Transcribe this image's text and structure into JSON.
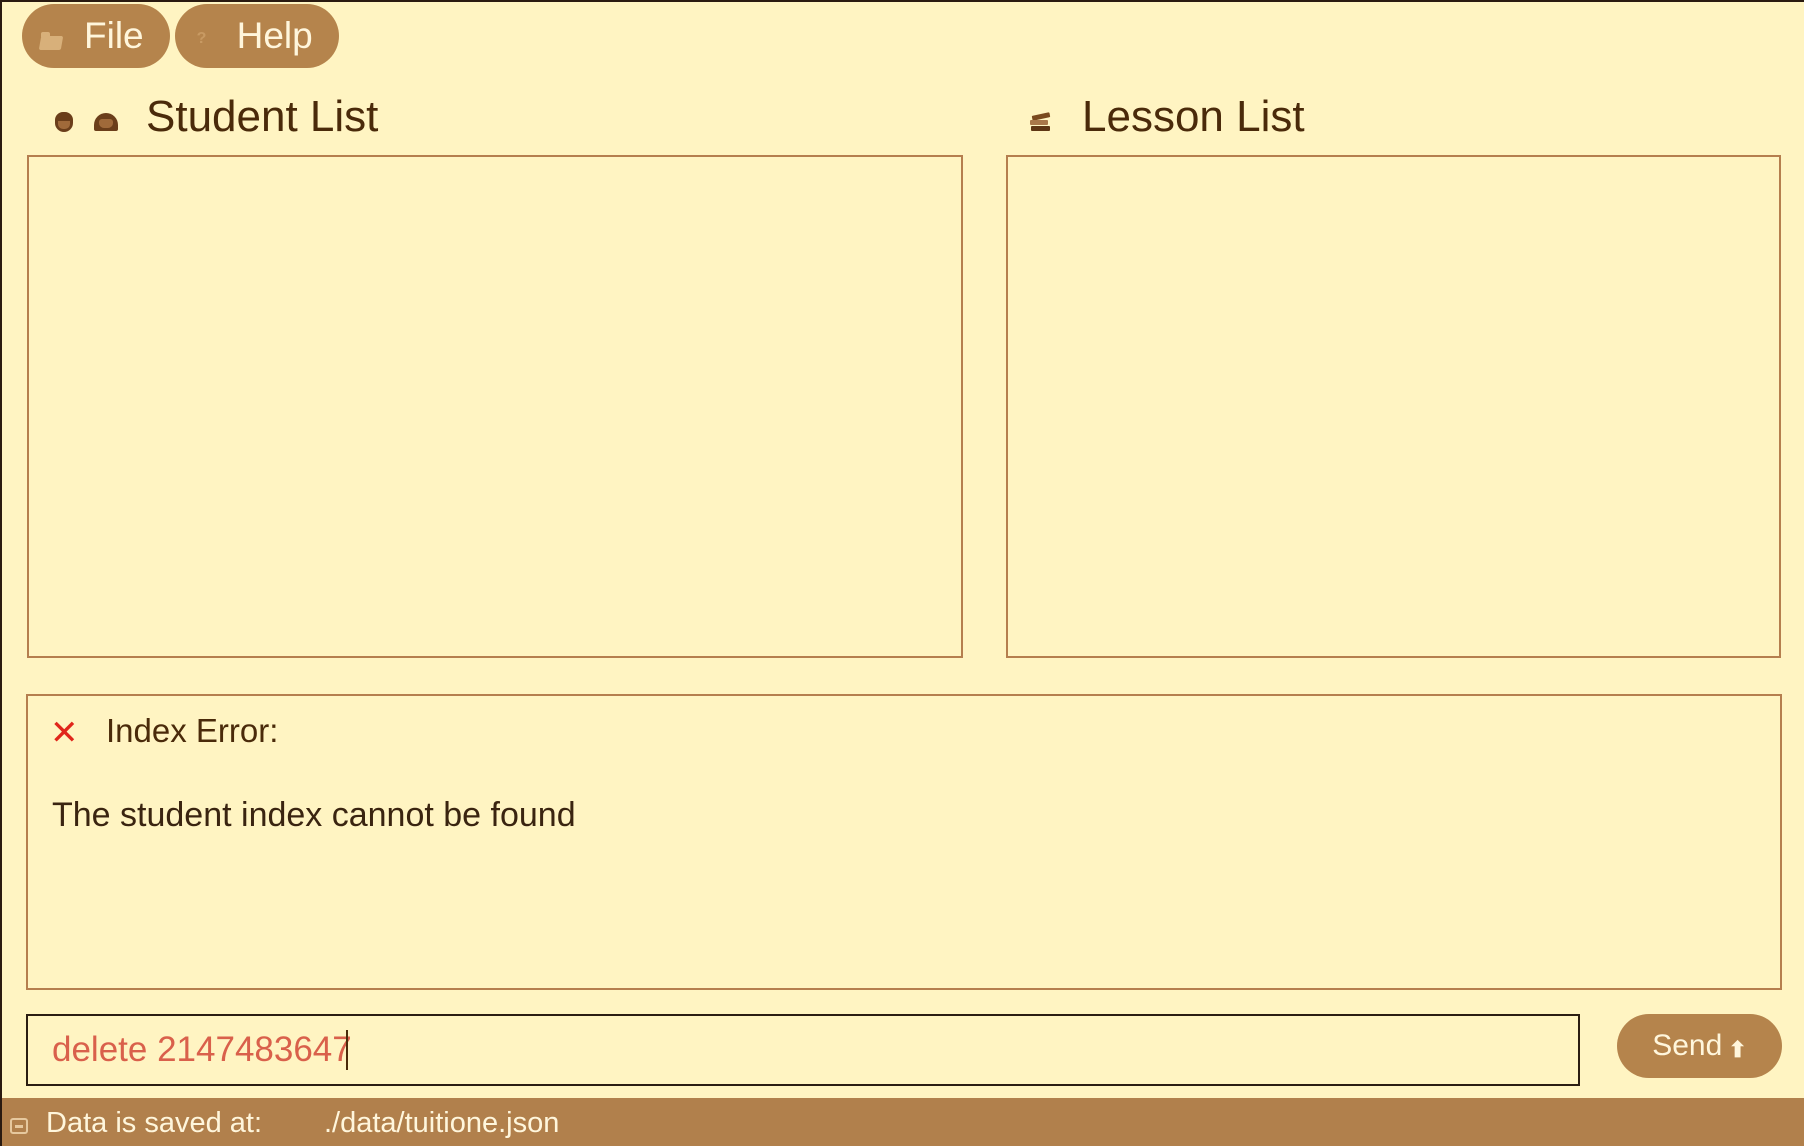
{
  "menu": {
    "file_label": "File",
    "help_label": "Help"
  },
  "student_panel": {
    "title": "Student List",
    "icons": [
      "boy-face-icon",
      "girl-face-icon"
    ]
  },
  "lesson_panel": {
    "title": "Lesson List",
    "icon": "books-icon"
  },
  "result": {
    "icon": "cross-icon",
    "icon_glyph": "✕",
    "title": "Index Error:",
    "message": "The student index cannot be found"
  },
  "command": {
    "value": "delete 2147483647"
  },
  "send_button": {
    "label": "Send",
    "icon_glyph": "⬆"
  },
  "status": {
    "label": "Data is saved at:",
    "path": "./data/tuitione.json"
  },
  "colors": {
    "background": "#fff4c2",
    "accent": "#b5844c",
    "text": "#4a2a0a",
    "error": "#e0261b",
    "command_text": "#d9604b"
  }
}
